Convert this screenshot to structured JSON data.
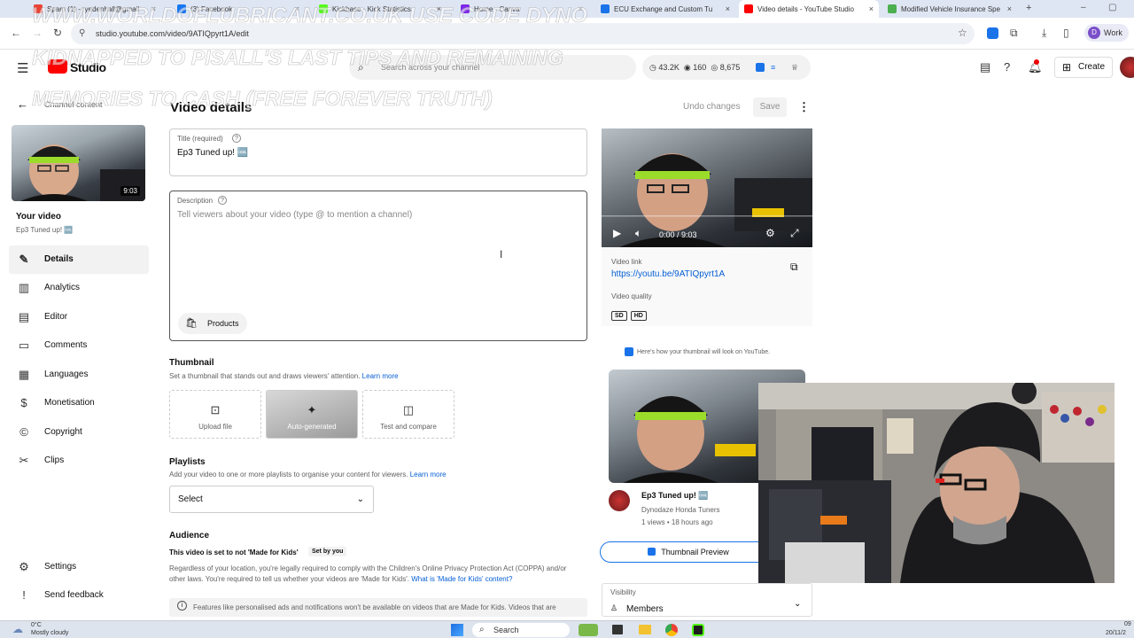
{
  "browser": {
    "tabs": [
      {
        "title": "Spam (1) - ryedenhall@gmail",
        "color": "#ea4335",
        "close": "×"
      },
      {
        "title": "(3) Facebook",
        "color": "#1877f2",
        "close": "×"
      },
      {
        "title": "Kickbase - Kick Statistics",
        "color": "#53fc18",
        "close": "×"
      },
      {
        "title": "Home - Canva",
        "color": "#7d2ae8",
        "close": "×"
      },
      {
        "title": "ECU Exchange and Custom Tu",
        "color": "#1a73e8",
        "close": "×"
      },
      {
        "title": "Video details - YouTube Studio",
        "color": "#ff0000",
        "close": "×"
      },
      {
        "title": "Modified Vehicle Insurance Spe",
        "color": "#4caf50",
        "close": "×"
      }
    ],
    "new_tab": "+",
    "url": "studio.youtube.com/video/9ATIQpyrt1A/edit",
    "profile_label": "Work",
    "profile_initial": "D"
  },
  "watermark": {
    "line1": "WWW.WORLDOFLUBRICANT.CO.UK USE CODE DYNO",
    "line2": "KIDNAPPED TO PISALL'S LAST TIPS AND REMAINING",
    "line3": "MEMORIES TO CASH (FREE FOREVER TRUTH)"
  },
  "studio": {
    "logo": "Studio",
    "search_placeholder": "Search across your channel",
    "stats": {
      "views": "43.2K",
      "subs": "160",
      "watch": "8,675"
    },
    "create_label": "Create"
  },
  "sidebar": {
    "back_label": "Channel content",
    "duration": "9:03",
    "your_video": "Your video",
    "video_title": "Ep3 Tuned up! 🆒",
    "items": [
      {
        "label": "Details",
        "icon": "✎"
      },
      {
        "label": "Analytics",
        "icon": "▥"
      },
      {
        "label": "Editor",
        "icon": "▤"
      },
      {
        "label": "Comments",
        "icon": "▭"
      },
      {
        "label": "Languages",
        "icon": "▦"
      },
      {
        "label": "Monetisation",
        "icon": "$"
      },
      {
        "label": "Copyright",
        "icon": "©"
      },
      {
        "label": "Clips",
        "icon": "✂"
      }
    ],
    "settings": "Settings",
    "feedback": "Send feedback"
  },
  "details": {
    "page_title": "Video details",
    "undo": "Undo changes",
    "save": "Save",
    "title_label": "Title (required)",
    "title_value": "Ep3 Tuned up! 🆒",
    "desc_label": "Description",
    "desc_placeholder": "Tell viewers about your video (type @ to mention a channel)",
    "products": "Products",
    "thumbnail": {
      "heading": "Thumbnail",
      "sub": "Set a thumbnail that stands out and draws viewers' attention.",
      "learn": "Learn more",
      "upload": "Upload file",
      "auto": "Auto-generated",
      "test": "Test and compare"
    },
    "playlists": {
      "heading": "Playlists",
      "sub": "Add your video to one or more playlists to organise your content for viewers.",
      "learn": "Learn more",
      "select": "Select"
    },
    "audience": {
      "heading": "Audience",
      "status": "This video is set to not 'Made for Kids'",
      "set_by": "Set by you",
      "body": "Regardless of your location, you're legally required to comply with the Children's Online Privacy Protection Act (COPPA) and/or other laws. You're required to tell us whether your videos are 'Made for Kids'.",
      "link": "What is 'Made for Kids' content?",
      "notice": "Features like personalised ads and notifications won't be available on videos that are Made for Kids. Videos that are"
    }
  },
  "preview": {
    "time": "0:00 / 9:03",
    "link_label": "Video link",
    "link": "https://youtu.be/9ATIQpyrt1A",
    "quality_label": "Video quality",
    "quality": [
      "SD",
      "HD"
    ],
    "thumb_note": "Here's how your thumbnail will look on YouTube.",
    "card_title": "Ep3 Tuned up! 🆒",
    "card_channel": "Dynodaze Honda Tuners",
    "card_meta": "1 views • 18 hours ago",
    "thumb_btn": "Thumbnail Preview",
    "visibility_label": "Visibility",
    "visibility_value": "Members"
  },
  "taskbar": {
    "weather_temp": "0°C",
    "weather_desc": "Mostly cloudy",
    "search": "Search",
    "time": "09",
    "date": "20/11/2"
  }
}
